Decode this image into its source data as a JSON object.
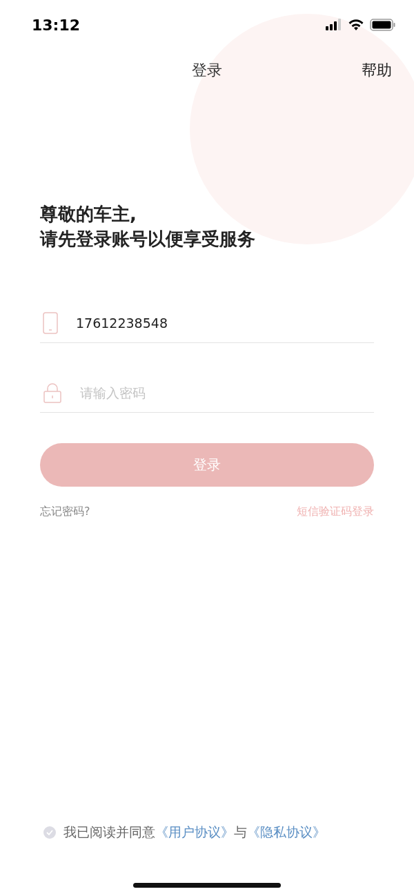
{
  "status_bar": {
    "time": "13:12"
  },
  "nav": {
    "title": "登录",
    "action": "帮助"
  },
  "heading": [
    "尊敬的车主,",
    "请先登录账号以便享受服务"
  ],
  "fields": [
    {
      "kind": "phone",
      "value": "17612238548"
    },
    {
      "kind": "password",
      "placeholder": "请输入密码"
    }
  ],
  "login_button": {
    "label": "登录",
    "disabled": true
  },
  "links": {
    "forgot": "忘记密码?",
    "sms_login": "短信验证码登录"
  },
  "agreement": {
    "checked": false,
    "parts": [
      {
        "kind": "text",
        "text": "我已阅读并同意"
      },
      {
        "kind": "link",
        "text": "《用户协议》"
      },
      {
        "kind": "text",
        "text": "与"
      },
      {
        "kind": "link",
        "text": "《隐私协议》"
      }
    ]
  }
}
